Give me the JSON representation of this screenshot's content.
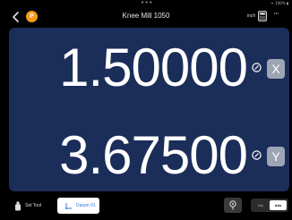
{
  "status_bar": {
    "dots": "•••",
    "right_text": "ᯤ 100% ▮"
  },
  "header": {
    "badge": "P",
    "title": "Knee Mill 1050",
    "unit_label": "inch",
    "more_label": "···"
  },
  "dro": {
    "axes": [
      {
        "axis": "X",
        "value": "1.50000"
      },
      {
        "axis": "Y",
        "value": "3.67500"
      }
    ]
  },
  "toolbar": {
    "set_tool_label": "Set Tool",
    "datum_label": "Datum 01",
    "mode_inc": "Inc",
    "mode_abs": "Abs",
    "selected_mode": "Abs"
  },
  "colors": {
    "panel": "#1b2d59",
    "accent_orange": "#f39a18",
    "accent_blue": "#2f77e2",
    "axis_button": "#9da4b4"
  },
  "icons": {
    "back": "chevron-left-icon",
    "calculator": "calculator-icon",
    "more": "ellipsis-icon",
    "probe": "probe-icon",
    "set_tool": "tool-icon",
    "datum": "datum-axes-icon"
  }
}
